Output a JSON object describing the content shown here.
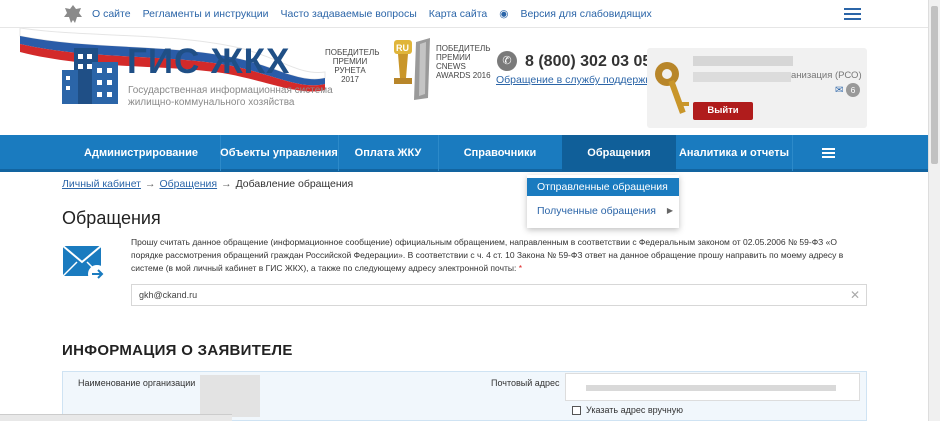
{
  "topbar": {
    "links": [
      "О сайте",
      "Регламенты и инструкции",
      "Часто задаваемые вопросы",
      "Карта сайта"
    ],
    "accessibility": "Версия для слабовидящих"
  },
  "header": {
    "logo_title": "ГИС ЖКХ",
    "logo_subtitle": "Государственная информационная система жилищно-коммунального хозяйства",
    "award_runet": "ПОБЕДИТЕЛЬ ПРЕМИИ РУНЕТА 2017",
    "award_runet_badge": "RU",
    "award_cnews": "ПОБЕДИТЕЛЬ ПРЕМИИ CNEWS AWARDS 2016",
    "phone": "8 (800) 302 03 05",
    "support_link": "Обращение в службу поддержки",
    "org_suffix": "анизация (РСО)",
    "message_count": "6",
    "logout_label": "Выйти"
  },
  "nav": {
    "items": [
      "Администрирование",
      "Объекты управления",
      "Оплата ЖКУ",
      "Справочники",
      "Обращения",
      "Аналитика и отчеты"
    ],
    "active": "Обращения"
  },
  "breadcrumb": {
    "home": "Личный кабинет",
    "section": "Обращения",
    "current": "Добавление обращения",
    "separator": "→"
  },
  "dropdown": {
    "items": [
      "Отправленные обращения",
      "Полученные обращения"
    ],
    "selected": "Отправленные обращения"
  },
  "main": {
    "title": "Обращения",
    "notice": "Прошу считать данное обращение (информационное сообщение) официальным обращением, направленным в соответствии с Федеральным законом от 02.05.2006 № 59-ФЗ «О порядке рассмотрения обращений граждан Российской Федерации». В соответствии с ч. 4 ст. 10 Закона № 59-ФЗ ответ на данное обращение прошу направить по моему адресу в системе (в мой личный кабинет в ГИС ЖКХ), а также по следующему адресу электронной почты:",
    "required_mark": "*",
    "email_value": "gkh@ckand.ru",
    "applicant_title": "ИНФОРМАЦИЯ О ЗАЯВИТЕЛЕ",
    "org_name_label": "Наименование организации",
    "postal_label": "Почтовый адрес",
    "manual_address_label": "Указать адрес вручную"
  },
  "colors": {
    "nav_bg": "#1a7bbf",
    "nav_active": "#105f99",
    "link": "#2b65a8",
    "logout": "#b01c1c"
  }
}
